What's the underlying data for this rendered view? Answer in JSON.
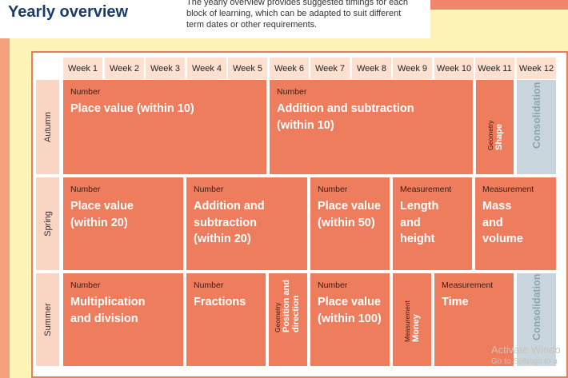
{
  "header": {
    "title": "Yearly overview",
    "intro_lines": [
      "The yearly overview provides suggested timings for each",
      "block of learning, which can be adapted to suit different",
      "term dates or other requirements."
    ]
  },
  "weeks": [
    "Week 1",
    "Week 2",
    "Week 3",
    "Week 4",
    "Week 5",
    "Week 6",
    "Week 7",
    "Week 8",
    "Week 9",
    "Week 10",
    "Week 11",
    "Week 12"
  ],
  "terms": [
    {
      "name": "Autumn",
      "blocks": [
        {
          "category": "Number",
          "lines": [
            "Place value (within 10)"
          ]
        },
        {
          "category": "Number",
          "lines": [
            "Addition and subtraction",
            "(within 10)"
          ]
        },
        {
          "category": "Geometry",
          "lines": [
            "Shape"
          ]
        },
        {
          "category": "",
          "lines": [
            "Consolidation"
          ]
        }
      ]
    },
    {
      "name": "Spring",
      "blocks": [
        {
          "category": "Number",
          "lines": [
            "Place value",
            "(within 20)"
          ]
        },
        {
          "category": "Number",
          "lines": [
            "Addition and",
            "subtraction",
            "(within 20)"
          ]
        },
        {
          "category": "Number",
          "lines": [
            "Place value",
            "(within 50)"
          ]
        },
        {
          "category": "Measurement",
          "lines": [
            "Length",
            "and",
            "height"
          ]
        },
        {
          "category": "Measurement",
          "lines": [
            "Mass",
            "and",
            "volume"
          ]
        }
      ]
    },
    {
      "name": "Summer",
      "blocks": [
        {
          "category": "Number",
          "lines": [
            "Multiplication",
            "and division"
          ]
        },
        {
          "category": "Number",
          "lines": [
            "Fractions"
          ]
        },
        {
          "category": "Geometry",
          "lines": [
            "Position and",
            "direction"
          ]
        },
        {
          "category": "Number",
          "lines": [
            "Place value",
            "(within 100)"
          ]
        },
        {
          "category": "Measurement",
          "lines": [
            "Money"
          ]
        },
        {
          "category": "Measurement",
          "lines": [
            "Time"
          ]
        },
        {
          "category": "",
          "lines": [
            "Consolidation"
          ]
        }
      ]
    }
  ],
  "watermark": {
    "line1": "Activate Windo",
    "line2": "Go to Settings to a"
  }
}
